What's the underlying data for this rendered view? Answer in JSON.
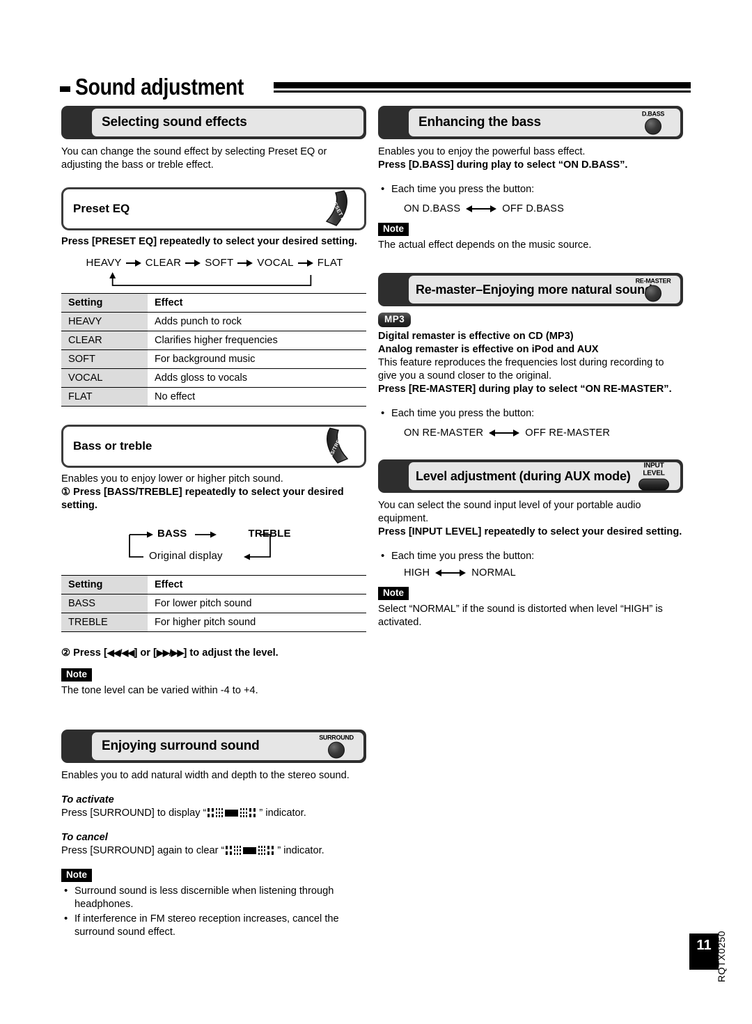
{
  "page": {
    "title": "Sound adjustment",
    "model_code": "RQTX0250",
    "page_number": "11"
  },
  "left_column": {
    "section1": {
      "header": "Selecting sound effects",
      "intro": "You can change the sound effect by selecting Preset EQ or adjusting the bass or treble effect.",
      "subsection_preset": {
        "title": "Preset EQ",
        "button_label": "PRESET EQ",
        "instruction": "Press [PRESET EQ] repeatedly to select your desired setting.",
        "flow": [
          "HEAVY",
          "CLEAR",
          "SOFT",
          "VOCAL",
          "FLAT"
        ],
        "table": {
          "headers": [
            "Setting",
            "Effect"
          ],
          "rows": [
            [
              "HEAVY",
              "Adds punch to rock"
            ],
            [
              "CLEAR",
              "Clarifies higher frequencies"
            ],
            [
              "SOFT",
              "For background music"
            ],
            [
              "VOCAL",
              "Adds gloss to vocals"
            ],
            [
              "FLAT",
              "No effect"
            ]
          ]
        }
      },
      "subsection_basstreble": {
        "title": "Bass or treble",
        "button_label": "BASS/TREBLE",
        "intro": "Enables you to enjoy lower or higher pitch sound.",
        "step1": "① Press [BASS/TREBLE] repeatedly to select your desired setting.",
        "flow_top": [
          "BASS",
          "TREBLE"
        ],
        "flow_bottom": "Original display",
        "table": {
          "headers": [
            "Setting",
            "Effect"
          ],
          "rows": [
            [
              "BASS",
              "For lower pitch sound"
            ],
            [
              "TREBLE",
              "For higher pitch sound"
            ]
          ]
        },
        "step2_prefix": "② Press [",
        "step2_rew": "◀◀/◀◀",
        "step2_mid": "] or [",
        "step2_ff": "▶▶/▶▶",
        "step2_suffix": "] to adjust the level.",
        "note_label": "Note",
        "note_text": "The tone level can be varied within -4 to +4."
      }
    },
    "section2": {
      "header": "Enjoying surround sound",
      "button_label": "SURROUND",
      "intro": "Enables you to add natural width and depth to the stereo sound.",
      "activate_heading": "To activate",
      "activate_prefix": "Press [SURROUND] to display “",
      "activate_suffix": "” indicator.",
      "cancel_heading": "To cancel",
      "cancel_prefix": "Press [SURROUND] again to clear “",
      "cancel_suffix": "” indicator.",
      "note_label": "Note",
      "note_bullets": [
        "Surround sound is less discernible when listening through headphones.",
        "If interference in FM stereo reception increases, cancel the surround sound effect."
      ]
    }
  },
  "right_column": {
    "section1": {
      "header": "Enhancing the bass",
      "button_label": "D.BASS",
      "intro": "Enables you to enjoy the powerful bass effect.",
      "instruction": "Press [D.BASS] during play to select “ON D.BASS”.",
      "bullet": "Each time you press the button:",
      "toggle_left": "ON D.BASS",
      "toggle_right": "OFF D.BASS",
      "note_label": "Note",
      "note_text": "The actual effect depends on the music source."
    },
    "section2": {
      "header": "Re-master–Enjoying more natural sound",
      "button_label": "RE-MASTER",
      "badge": "MP3",
      "line1": "Digital remaster is effective on CD (MP3)",
      "line2": "Analog remaster is effective on iPod and AUX",
      "body": "This feature reproduces the frequencies lost during recording to give you a sound closer to the original.",
      "instruction": "Press [RE-MASTER] during play to select “ON RE-MASTER”.",
      "bullet": "Each time you press the button:",
      "toggle_left": "ON RE-MASTER",
      "toggle_right": "OFF RE-MASTER"
    },
    "section3": {
      "header": "Level adjustment (during AUX mode)",
      "button_label_line1": "INPUT",
      "button_label_line2": "LEVEL",
      "intro": "You can select the sound input level of your portable audio equipment.",
      "instruction": "Press [INPUT LEVEL] repeatedly to select your desired setting.",
      "bullet": "Each time you press the button:",
      "toggle_left": "HIGH",
      "toggle_right": "NORMAL",
      "note_label": "Note",
      "note_text": "Select “NORMAL” if the sound is distorted when level “HIGH” is activated."
    }
  },
  "icons": {
    "surround_indicator": "surround-indicator-icon",
    "preset_eq_button": "preset-eq-button-icon",
    "bass_treble_button": "bass-treble-button-icon",
    "dbass_button": "dbass-button-icon",
    "remaster_button": "remaster-button-icon",
    "surround_button": "surround-button-icon",
    "input_level_button": "input-level-button-icon"
  },
  "colors": {
    "header_band": "#2e2e2e",
    "header_inner": "#e6e6e6",
    "table_label_cell": "#dcdcdc",
    "text": "#000000"
  }
}
